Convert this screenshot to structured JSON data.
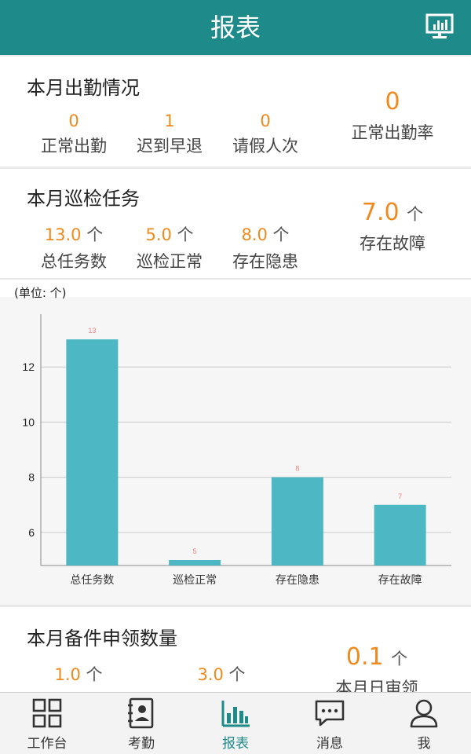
{
  "header": {
    "title": "报表",
    "screen_icon": "monitor-chart-icon"
  },
  "attendance": {
    "title": "本月出勤情况",
    "stats": [
      {
        "value": "0",
        "label": "正常出勤"
      },
      {
        "value": "1",
        "label": "迟到早退"
      },
      {
        "value": "0",
        "label": "请假人次"
      }
    ],
    "rate": {
      "value": "0",
      "label": "正常出勤率"
    }
  },
  "inspection": {
    "title": "本月巡检任务",
    "unit": "个",
    "stats": [
      {
        "value": "13.0",
        "label": "总任务数"
      },
      {
        "value": "5.0",
        "label": "巡检正常"
      },
      {
        "value": "8.0",
        "label": "存在隐患"
      }
    ],
    "fault": {
      "value": "7.0",
      "label": "存在故障"
    }
  },
  "chart_unit_label": "(单位: 个)",
  "chart_data": {
    "type": "bar",
    "categories": [
      "总任务数",
      "巡检正常",
      "存在隐患",
      "存在故障"
    ],
    "values": [
      13,
      5,
      8,
      7
    ],
    "ylim": [
      4.8,
      13.8
    ],
    "yticks": [
      6,
      8,
      10,
      12
    ],
    "grid": true,
    "bar_color": "#4db8c4",
    "label_color": "#f08080"
  },
  "spare_parts": {
    "title": "本月备件申领数量",
    "unit": "个",
    "stats": [
      {
        "value": "1.0"
      },
      {
        "value": "3.0"
      }
    ],
    "big": {
      "value": "0.1",
      "label": "本月日审领"
    }
  },
  "tabs": [
    {
      "label": "工作台",
      "icon": "workbench-grid-icon"
    },
    {
      "label": "考勤",
      "icon": "attendance-book-icon"
    },
    {
      "label": "报表",
      "icon": "report-chart-icon"
    },
    {
      "label": "消息",
      "icon": "message-bubble-icon"
    },
    {
      "label": "我",
      "icon": "profile-person-icon"
    }
  ],
  "colors": {
    "brand": "#1e8a8a",
    "accent": "#f08a1c"
  }
}
